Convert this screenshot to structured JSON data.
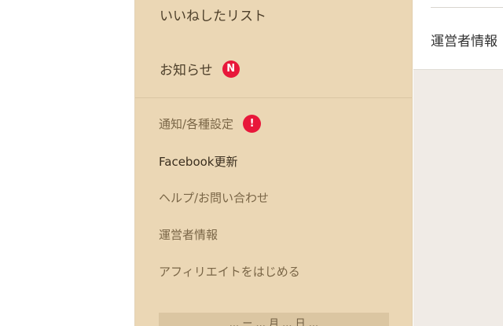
{
  "menu": {
    "primary": [
      {
        "label": "いいねしたリスト"
      },
      {
        "label": "お知らせ",
        "badge": "N",
        "badge_color": "#e8173a"
      }
    ],
    "secondary": [
      {
        "label": "通知/各種設定",
        "badge": "!",
        "badge_color": "#e8173a"
      },
      {
        "label": "Facebook更新"
      },
      {
        "label": "ヘルプ/お問い合わせ"
      },
      {
        "label": "運営者情報"
      },
      {
        "label": "アフィリエイトをはじめる"
      }
    ],
    "bottom_banner": "... ー ... 月 ... 日 ..."
  },
  "right_card": {
    "text": "運営者情報"
  },
  "colors": {
    "menu_background": "#ebd7b5",
    "badge_red": "#e8173a",
    "page_background": "#f0ebe6"
  }
}
